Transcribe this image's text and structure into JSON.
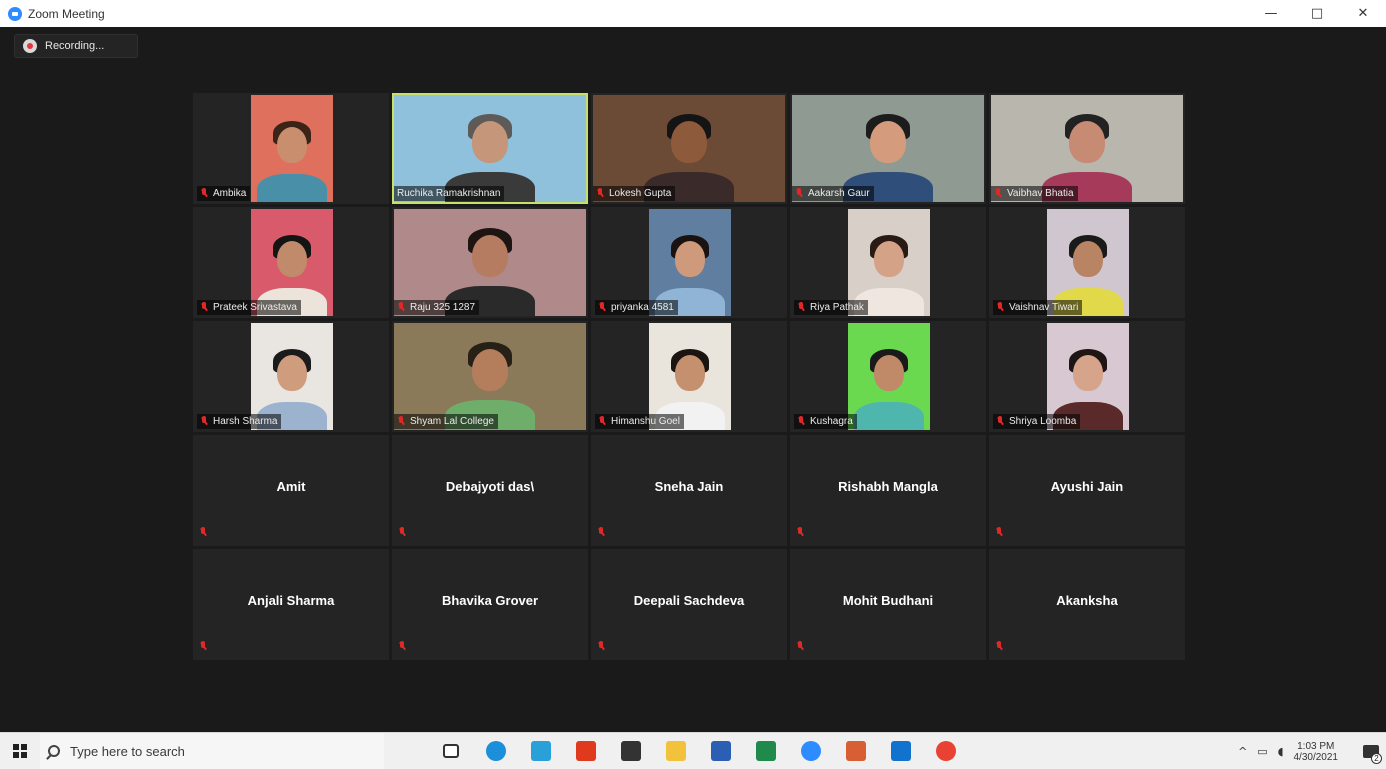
{
  "window": {
    "title": "Zoom Meeting",
    "controls": {
      "minimize": "—",
      "maximize": "□",
      "close": "✕"
    }
  },
  "recording": {
    "label": "Recording..."
  },
  "participants_video": [
    {
      "name": "Ambika",
      "layout": "narrow",
      "colors": {
        "bg": "#e0705e",
        "hair": "#3a2418",
        "skin": "#c98e6e",
        "body": "#4a8fa8"
      }
    },
    {
      "name": "Ruchika Ramakrishnan",
      "layout": "wide",
      "active": true,
      "colors": {
        "bg": "#8fc0dc",
        "hair": "#5d5a57",
        "skin": "#c6967a",
        "body": "#3a3a3a"
      }
    },
    {
      "name": "Lokesh Gupta",
      "layout": "wide",
      "colors": {
        "bg": "#6b4a36",
        "hair": "#141414",
        "skin": "#8d5a3c",
        "body": "#3b2a2a"
      }
    },
    {
      "name": "Aakarsh Gaur",
      "layout": "wide",
      "colors": {
        "bg": "#8f9a92",
        "hair": "#1c1c1c",
        "skin": "#d49c7c",
        "body": "#2f4f7a"
      }
    },
    {
      "name": "Vaibhav Bhatia",
      "layout": "wide",
      "colors": {
        "bg": "#b9b6ae",
        "hair": "#222222",
        "skin": "#c78a72",
        "body": "#a53a5a"
      }
    },
    {
      "name": "Prateek Srivastava",
      "layout": "narrow",
      "colors": {
        "bg": "#d95a6a",
        "hair": "#141414",
        "skin": "#c18a6a",
        "body": "#ece4da"
      }
    },
    {
      "name": "Raju 325 1287",
      "layout": "wide",
      "colors": {
        "bg": "#b08a8a",
        "hair": "#1e1412",
        "skin": "#b67c62",
        "body": "#2a2a2a"
      }
    },
    {
      "name": "priyanka 4581",
      "layout": "narrow",
      "colors": {
        "bg": "#5f7ea0",
        "hair": "#1a1210",
        "skin": "#cf9a7c",
        "body": "#8fb4d6"
      }
    },
    {
      "name": "Riya Pathak",
      "layout": "narrow",
      "colors": {
        "bg": "#d8cfc8",
        "hair": "#2a1a14",
        "skin": "#d4a286",
        "body": "#efe6e0"
      }
    },
    {
      "name": "Vaishnav Tiwari",
      "layout": "narrow",
      "colors": {
        "bg": "#cfc6d0",
        "hair": "#1a1a1a",
        "skin": "#b98464",
        "body": "#e2d94a"
      }
    },
    {
      "name": "Harsh Sharma",
      "layout": "narrow",
      "colors": {
        "bg": "#e9e6e2",
        "hair": "#1b1b1b",
        "skin": "#cf9c7e",
        "body": "#9bb3cf"
      }
    },
    {
      "name": "Shyam Lal College",
      "layout": "wide",
      "colors": {
        "bg": "#8a7a5a",
        "hair": "#262016",
        "skin": "#b47e5c",
        "body": "#6fae6a"
      }
    },
    {
      "name": "Himanshu Goel",
      "layout": "narrow",
      "colors": {
        "bg": "#e9e4dc",
        "hair": "#1b1410",
        "skin": "#c4906e",
        "body": "#f2f2f2"
      }
    },
    {
      "name": "Kushagra",
      "layout": "narrow",
      "colors": {
        "bg": "#6bd94f",
        "hair": "#1a1a1a",
        "skin": "#c08a68",
        "body": "#4fb6ae"
      }
    },
    {
      "name": "Shriya Loomba",
      "layout": "narrow",
      "colors": {
        "bg": "#d8c8d2",
        "hair": "#1e1614",
        "skin": "#d6a48a",
        "body": "#5a2a2a"
      }
    }
  ],
  "participants_audio": [
    {
      "name": "Amit"
    },
    {
      "name": "Debajyoti das\\"
    },
    {
      "name": "Sneha Jain"
    },
    {
      "name": "Rishabh Mangla"
    },
    {
      "name": "Ayushi Jain"
    },
    {
      "name": "Anjali Sharma"
    },
    {
      "name": "Bhavika Grover"
    },
    {
      "name": "Deepali Sachdeva"
    },
    {
      "name": "Mohit Budhani"
    },
    {
      "name": "Akanksha"
    }
  ],
  "taskbar": {
    "search_placeholder": "Type here to search",
    "apps": [
      {
        "name": "task-view-icon",
        "color": "#ffffff"
      },
      {
        "name": "edge-icon",
        "color": "#1b8fd9"
      },
      {
        "name": "teams-icon",
        "color": "#2aa0d8"
      },
      {
        "name": "office-icon",
        "color": "#e03a1e"
      },
      {
        "name": "store-icon",
        "color": "#333333"
      },
      {
        "name": "file-explorer-icon",
        "color": "#f2c23c"
      },
      {
        "name": "word-icon",
        "color": "#2b5fb3"
      },
      {
        "name": "excel-icon",
        "color": "#1f8a4c"
      },
      {
        "name": "zoom-icon",
        "color": "#2d8cff"
      },
      {
        "name": "powerpoint-icon",
        "color": "#d85f33"
      },
      {
        "name": "mail-icon",
        "color": "#1273cf"
      },
      {
        "name": "chrome-icon",
        "color": "#e94235"
      }
    ],
    "tray": {
      "chevron": "^",
      "time": "1:03 PM",
      "date": "4/30/2021",
      "notification_count": "2"
    }
  }
}
